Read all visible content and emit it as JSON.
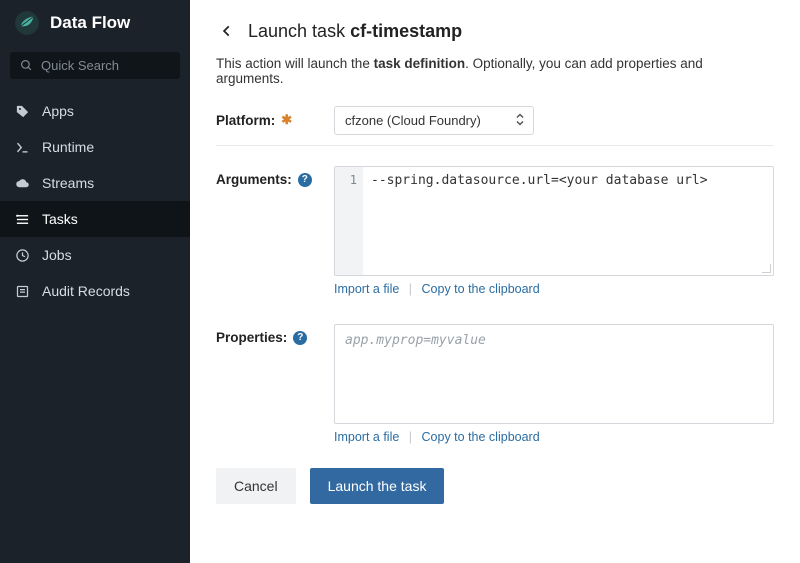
{
  "brand": "Data Flow",
  "search": {
    "placeholder": "Quick Search"
  },
  "nav": {
    "items": [
      {
        "label": "Apps"
      },
      {
        "label": "Runtime"
      },
      {
        "label": "Streams"
      },
      {
        "label": "Tasks"
      },
      {
        "label": "Jobs"
      },
      {
        "label": "Audit Records"
      }
    ]
  },
  "header": {
    "prefix": "Launch task ",
    "task_name": "cf-timestamp"
  },
  "intro": {
    "before": "This action will launch the ",
    "bold": "task definition",
    "after": ". Optionally, you can add properties and arguments."
  },
  "platform": {
    "label": "Platform:",
    "selected": "cfzone (Cloud Foundry)"
  },
  "arguments": {
    "label": "Arguments:",
    "line1": "--spring.datasource.url=<your database url>",
    "links": {
      "import": "Import a file",
      "copy": "Copy to the clipboard"
    }
  },
  "properties": {
    "label": "Properties:",
    "placeholder": "app.myprop=myvalue",
    "links": {
      "import": "Import a file",
      "copy": "Copy to the clipboard"
    }
  },
  "buttons": {
    "cancel": "Cancel",
    "launch": "Launch the task"
  }
}
